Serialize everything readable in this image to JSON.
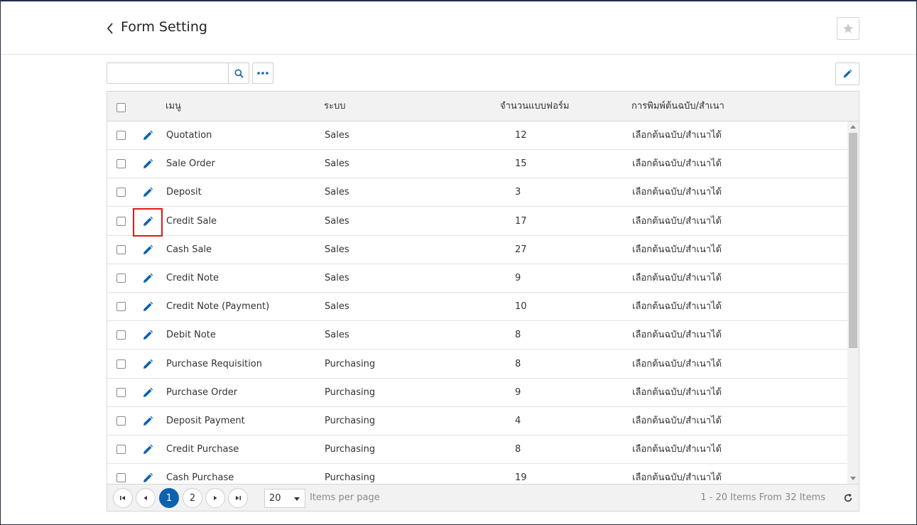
{
  "header": {
    "title": "Form Setting"
  },
  "toolbar": {
    "search_value": "",
    "search_placeholder": ""
  },
  "table": {
    "columns": {
      "menu": "เมนู",
      "system": "ระบบ",
      "count": "จำนวนแบบฟอร์ม",
      "print": "การพิมพ์ต้นฉบับ/สำเนา"
    },
    "rows": [
      {
        "menu": "Quotation",
        "system": "Sales",
        "count": "12",
        "print": "เลือกต้นฉบับ/สำเนาได้"
      },
      {
        "menu": "Sale Order",
        "system": "Sales",
        "count": "15",
        "print": "เลือกต้นฉบับ/สำเนาได้"
      },
      {
        "menu": "Deposit",
        "system": "Sales",
        "count": "3",
        "print": "เลือกต้นฉบับ/สำเนาได้"
      },
      {
        "menu": "Credit Sale",
        "system": "Sales",
        "count": "17",
        "print": "เลือกต้นฉบับ/สำเนาได้"
      },
      {
        "menu": "Cash Sale",
        "system": "Sales",
        "count": "27",
        "print": "เลือกต้นฉบับ/สำเนาได้"
      },
      {
        "menu": "Credit Note",
        "system": "Sales",
        "count": "9",
        "print": "เลือกต้นฉบับ/สำเนาได้"
      },
      {
        "menu": "Credit Note (Payment)",
        "system": "Sales",
        "count": "10",
        "print": "เลือกต้นฉบับ/สำเนาได้"
      },
      {
        "menu": "Debit Note",
        "system": "Sales",
        "count": "8",
        "print": "เลือกต้นฉบับ/สำเนาได้"
      },
      {
        "menu": "Purchase Requisition",
        "system": "Purchasing",
        "count": "8",
        "print": "เลือกต้นฉบับ/สำเนาได้"
      },
      {
        "menu": "Purchase Order",
        "system": "Purchasing",
        "count": "9",
        "print": "เลือกต้นฉบับ/สำเนาได้"
      },
      {
        "menu": "Deposit Payment",
        "system": "Purchasing",
        "count": "4",
        "print": "เลือกต้นฉบับ/สำเนาได้"
      },
      {
        "menu": "Credit Purchase",
        "system": "Purchasing",
        "count": "8",
        "print": "เลือกต้นฉบับ/สำเนาได้"
      },
      {
        "menu": "Cash Purchase",
        "system": "Purchasing",
        "count": "19",
        "print": "เลือกต้นฉบับ/สำเนาได้"
      }
    ],
    "highlighted_row": 3
  },
  "pager": {
    "pages": [
      "1",
      "2"
    ],
    "current": "1",
    "page_size": "20",
    "items_per_page_label": "Items per page",
    "summary": "1 - 20 Items From 32 Items"
  },
  "colors": {
    "accent": "#0d62b0",
    "highlight": "#e01818"
  }
}
